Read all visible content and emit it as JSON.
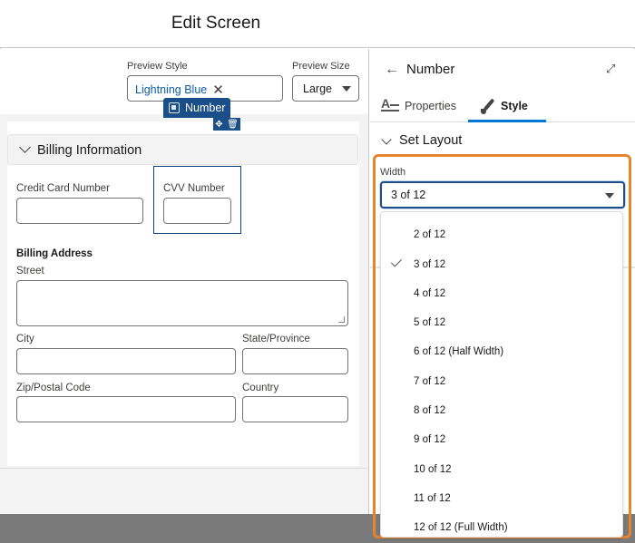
{
  "header": {
    "title": "Edit Screen"
  },
  "preview": {
    "style_label": "Preview Style",
    "style_value": "Lightning Blue",
    "size_label": "Preview Size",
    "size_value": "Large"
  },
  "section": {
    "title": "Billing Information"
  },
  "selected_component": {
    "badge": "Number"
  },
  "fields": {
    "credit_card": "Credit Card Number",
    "cvv": "CVV Number",
    "billing_address": "Billing Address",
    "street": "Street",
    "city": "City",
    "state": "State/Province",
    "zip": "Zip/Postal Code",
    "country": "Country"
  },
  "panel": {
    "title": "Number",
    "tabs": [
      {
        "label": "Properties",
        "active": false
      },
      {
        "label": "Style",
        "active": true
      }
    ],
    "section": "Set Layout",
    "width_label": "Width",
    "width_value": "3 of 12",
    "options": [
      "2 of 12",
      "3 of 12",
      "4 of 12",
      "5 of 12",
      "6 of 12 (Half Width)",
      "7 of 12",
      "8 of 12",
      "9 of 12",
      "10 of 12",
      "11 of 12",
      "12 of 12 (Full Width)"
    ],
    "selected_option": "3 of 12"
  },
  "colors": {
    "accent": "#0176d3",
    "highlight": "#e8842c",
    "badge": "#1b4f8a",
    "link": "#0b5cab"
  }
}
